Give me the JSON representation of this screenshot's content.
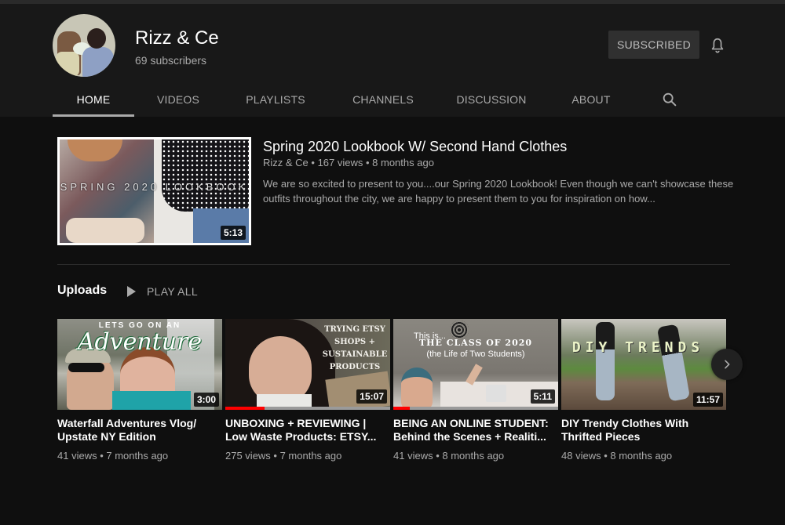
{
  "channel": {
    "name": "Rizz & Ce",
    "subscribers": "69 subscribers",
    "subscribe_button": "SUBSCRIBED",
    "bell_icon": "bell-icon",
    "avatar": "channel-avatar"
  },
  "tabs": [
    {
      "label": "HOME",
      "active": true
    },
    {
      "label": "VIDEOS",
      "active": false
    },
    {
      "label": "PLAYLISTS",
      "active": false
    },
    {
      "label": "CHANNELS",
      "active": false
    },
    {
      "label": "DISCUSSION",
      "active": false
    },
    {
      "label": "ABOUT",
      "active": false
    }
  ],
  "search_icon": "search-icon",
  "featured": {
    "thumbnail_text": "SPRING 2020 LOOKBOOK",
    "duration": "5:13",
    "title": "Spring 2020 Lookbook W/ Second Hand Clothes",
    "meta": "Rizz & Ce • 167 views • 8 months ago",
    "description": "We are so excited to present to you....our Spring 2020 Lookbook! Even though we can't showcase these outfits throughout the city, we are happy to present them to you for inspiration on how..."
  },
  "uploads": {
    "title": "Uploads",
    "play_all": "PLAY ALL",
    "videos": [
      {
        "thumb_text_top": "LETS GO ON AN",
        "thumb_text_main": "Adventure",
        "duration": "3:00",
        "title": "Waterfall Adventures Vlog/ Upstate NY Edition",
        "meta": "41 views • 7 months ago",
        "watched_fraction": 0
      },
      {
        "thumb_text_main": "TRYING ETSY SHOPS + SUSTAINABLE PRODUCTS",
        "duration": "15:07",
        "title": "UNBOXING + REVIEWING | Low Waste Products: ETSY...",
        "meta": "275 views • 7 months ago",
        "watched_fraction": 0.24
      },
      {
        "thumb_text_top": "This is...",
        "thumb_text_main": "THE CLASS OF 2020",
        "thumb_text_sub": "(the Life of Two Students)",
        "duration": "5:11",
        "title": "BEING AN ONLINE STUDENT: Behind the Scenes + Realiti...",
        "meta": "41 views • 8 months ago",
        "watched_fraction": 0.1
      },
      {
        "thumb_text_main": "DIY TRENDS",
        "duration": "11:57",
        "title": "DIY Trendy Clothes With Thrifted Pieces",
        "meta": "48 views • 8 months ago",
        "watched_fraction": 0
      }
    ]
  },
  "next_button": "chevron-right-icon",
  "colors": {
    "background": "#0f0f0f",
    "header": "#181818",
    "progress": "#ff0000",
    "secondary_text": "#aaaaaa"
  }
}
